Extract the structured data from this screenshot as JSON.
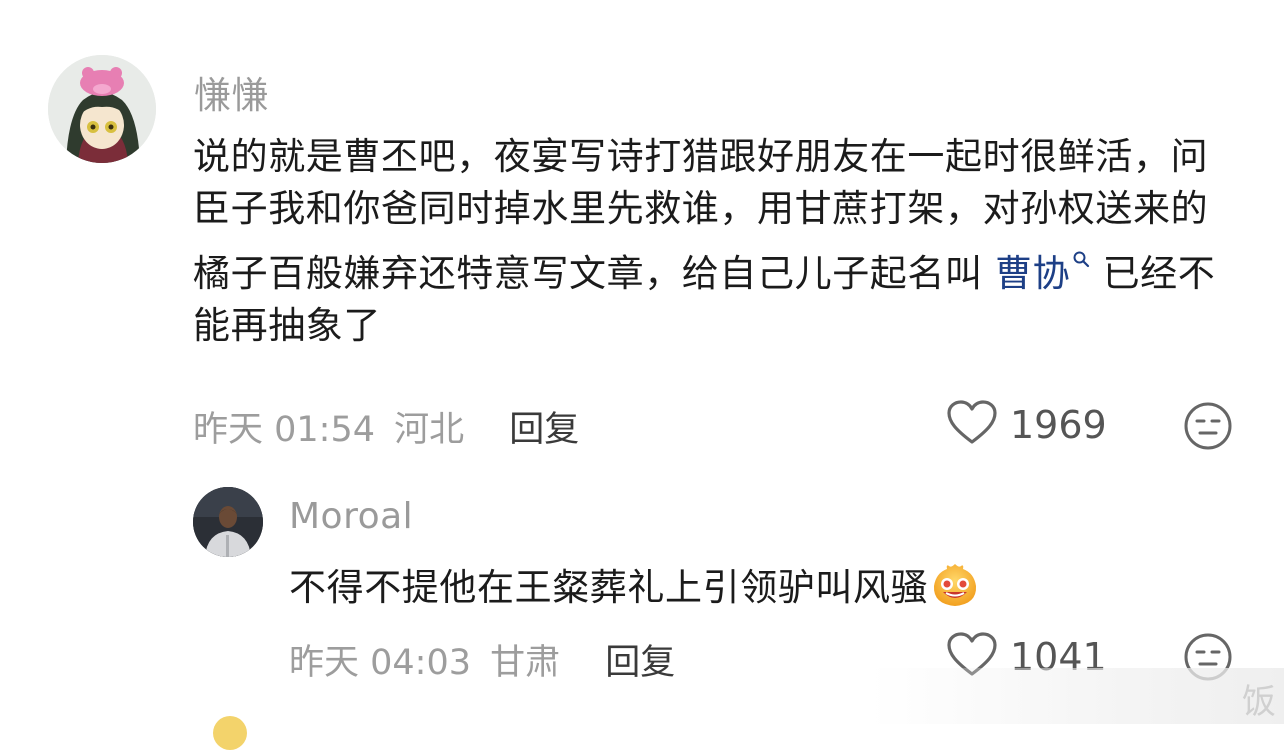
{
  "comments": [
    {
      "username": "慊慊",
      "text_before": "说的就是曹丕吧，夜宴写诗打猎跟好朋友在一起时很鲜活，问臣子我和你爸同时掉水里先救谁，用甘蔗打架，对孙权送来的橘子百般嫌弃还特意写文章，给自己儿子起名叫",
      "mention": "曹协",
      "text_after": "已经不能再抽象了",
      "time": "昨天 01:54",
      "location": "河北",
      "reply_label": "回复",
      "likes": "1969"
    },
    {
      "username": "Moroal",
      "text_before": "不得不提他在王粲葬礼上引领驴叫风骚",
      "time": "昨天 04:03",
      "location": "甘肃",
      "reply_label": "回复",
      "likes": "1041"
    }
  ],
  "watermark_char": "饭",
  "colors": {
    "mention": "#1d3f86",
    "meta": "#9d9d9d",
    "text": "#1b1b1b"
  },
  "icons": [
    "heart-outline-icon",
    "meh-face-icon",
    "search-icon",
    "grin-emoji-icon"
  ]
}
